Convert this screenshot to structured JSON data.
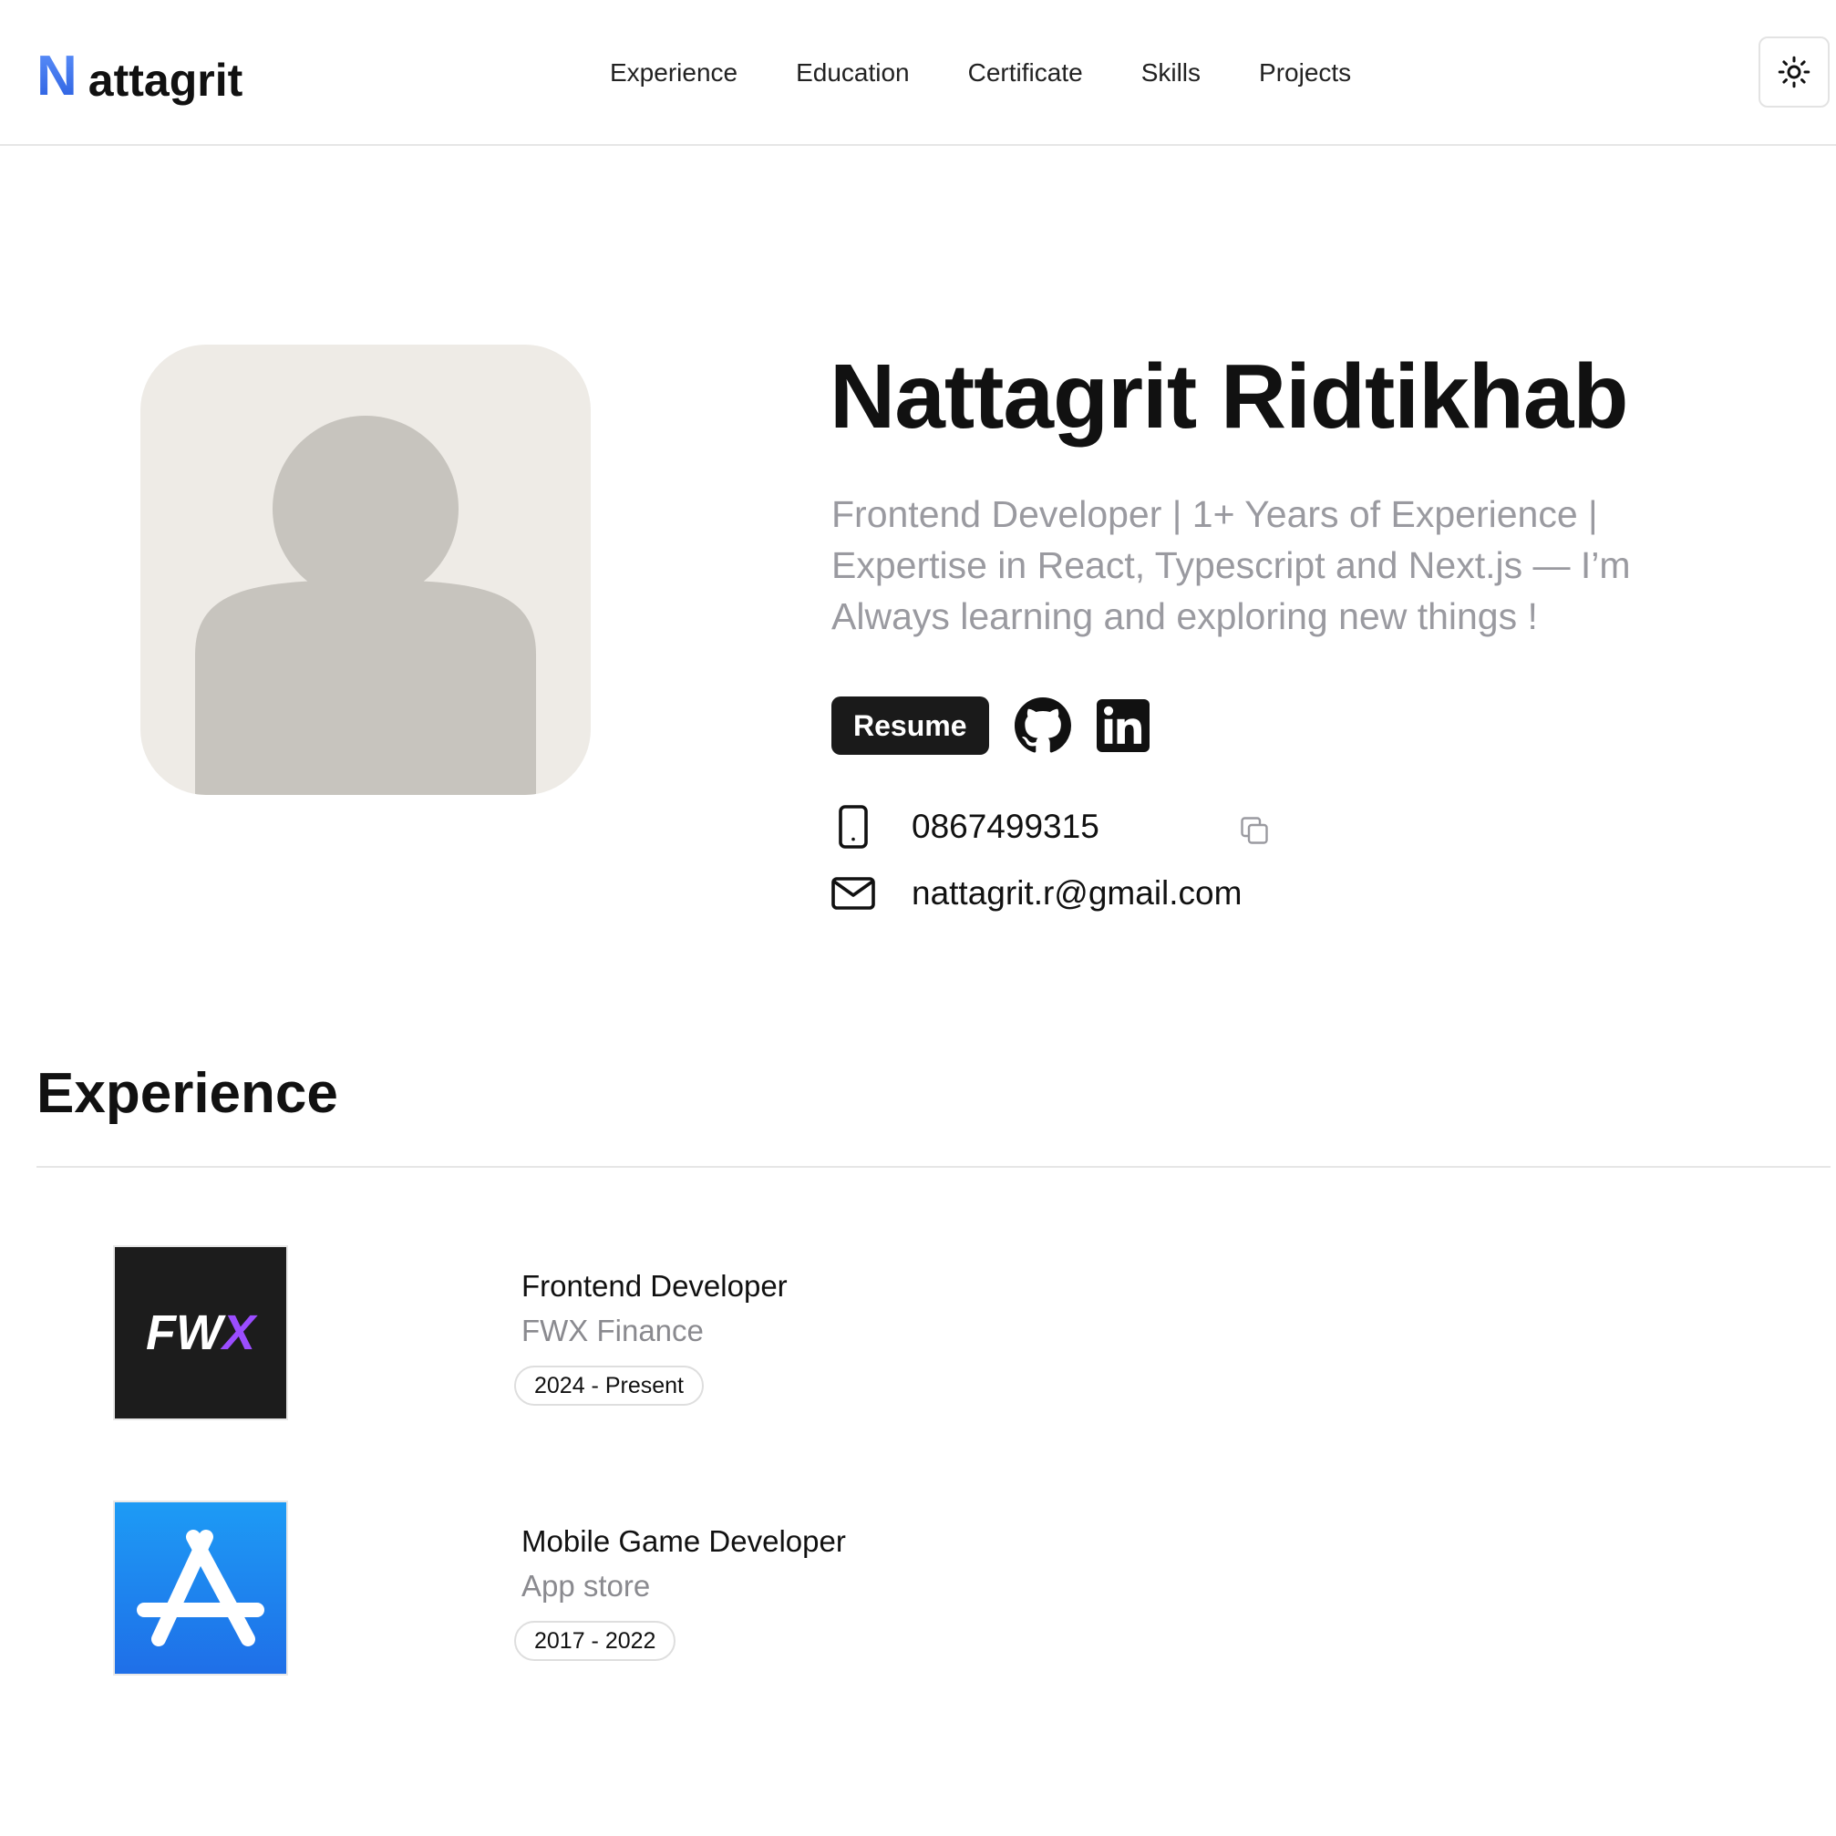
{
  "nav": {
    "logo_letter": "N",
    "logo_text": "attagrit",
    "links": [
      {
        "label": "Experience"
      },
      {
        "label": "Education"
      },
      {
        "label": "Certificate"
      },
      {
        "label": "Skills"
      },
      {
        "label": "Projects"
      }
    ],
    "theme_icon": "sun-icon"
  },
  "hero": {
    "name": "Nattagrit Ridtikhab",
    "description": "Frontend Developer | 1+ Years of Experience | Expertise in React, Typescript and Next.js — I’m Always learning and exploring new things !",
    "resume_label": "Resume",
    "social": [
      {
        "icon": "github-icon"
      },
      {
        "icon": "linkedin-icon"
      }
    ],
    "phone": "0867499315",
    "email": "nattagrit.r@gmail.com"
  },
  "experience": {
    "title": "Experience",
    "items": [
      {
        "role": "Frontend Developer",
        "company": "FWX Finance",
        "period": "2024 - Present",
        "logo_text": "FWX",
        "logo_bg": "#1c1c1c",
        "logo_accent": "#9b4dff"
      },
      {
        "role": "Mobile Game Developer",
        "company": "App store",
        "period": "2017 - 2022",
        "logo_icon": "app-store-icon",
        "logo_bg": "#1f8bf0"
      }
    ]
  },
  "colors": {
    "accent_blue": "#3f72ee",
    "muted_text": "#9a9aa0",
    "dark_button": "#1a1a1a"
  }
}
